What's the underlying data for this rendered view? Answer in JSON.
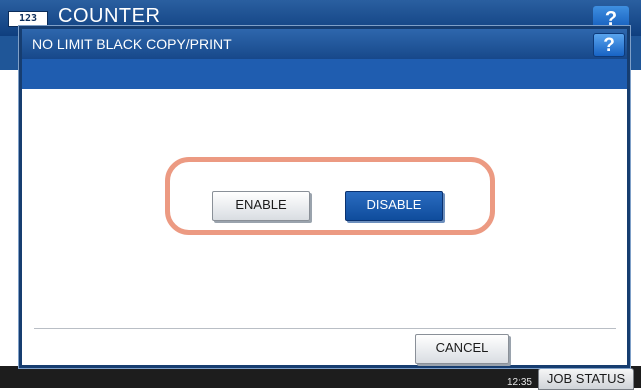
{
  "background": {
    "counter_icon": "123",
    "title": "COUNTER",
    "help_label": "?",
    "clock_line1": "",
    "clock_line2": "12:35",
    "job_status_label": "JOB STATUS"
  },
  "dialog": {
    "title": "NO LIMIT BLACK COPY/PRINT",
    "help_label": "?",
    "enable_label": "ENABLE",
    "disable_label": "DISABLE",
    "cancel_label": "CANCEL",
    "selected_option": "DISABLE"
  },
  "colors": {
    "titlebar": "#17488a",
    "selected_button": "#0f4c9c",
    "highlight_ring": "#ec9a82",
    "footer": "#1d1d1d"
  }
}
